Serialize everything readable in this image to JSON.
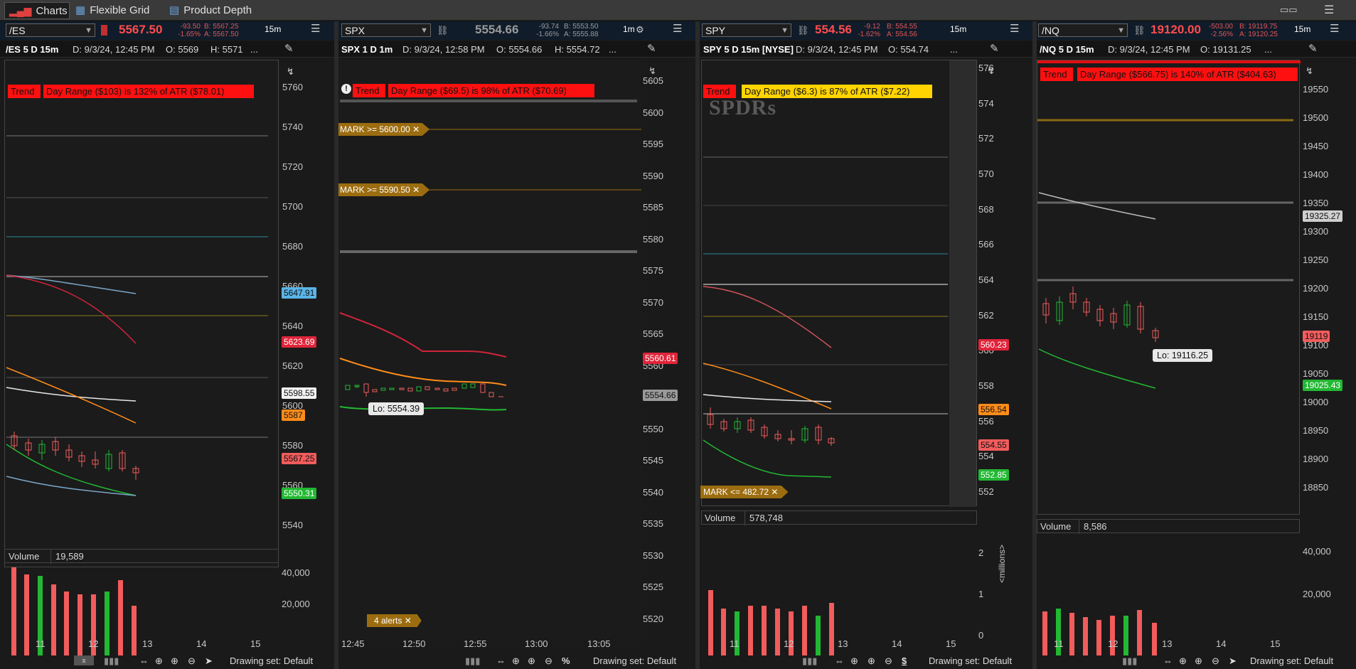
{
  "tabbar": {
    "tabs": [
      {
        "label": "Charts",
        "icon": "bar-chart-icon"
      },
      {
        "label": "Flexible Grid",
        "icon": "grid-icon"
      },
      {
        "label": "Product Depth",
        "icon": "depth-icon"
      }
    ]
  },
  "panels": [
    {
      "symbol": "/ES",
      "last": "5567.50",
      "last_color": "#ff4d4d",
      "change": "-93.50",
      "change_pct": "-1.65%",
      "bid": "B: 5567.25",
      "ask": "A: 5567.50",
      "timeframe": "15m",
      "info_title": "/ES 5 D 15m",
      "info_date": "D: 9/3/24, 12:45 PM",
      "info_open": "O: 5569",
      "info_high": "H: 5571",
      "info_more": "...",
      "badge_trend": "Trend",
      "badge_range": "Day Range ($103) is 132% of ATR ($78.01)",
      "y_ticks": [
        "5760",
        "5740",
        "5720",
        "5700",
        "5680",
        "5660",
        "5640",
        "5620",
        "5600",
        "5580",
        "5560",
        "5540"
      ],
      "tags": [
        {
          "text": "5647.91",
          "bg": "#5ab4e6",
          "fg": "#111"
        },
        {
          "text": "5623.69",
          "bg": "#e0243a",
          "fg": "#fff"
        },
        {
          "text": "5598.55",
          "bg": "#f2f2f2",
          "fg": "#111"
        },
        {
          "text": "5587",
          "bg": "#ff8c1a",
          "fg": "#111"
        },
        {
          "text": "5567.25",
          "bg": "#f25c5c",
          "fg": "#111"
        },
        {
          "text": "5550.31",
          "bg": "#22b833",
          "fg": "#fff"
        }
      ],
      "volume_label": "Volume",
      "volume_value": "19,589",
      "vol_ticks": [
        "40,000",
        "20,000"
      ],
      "x_ticks": [
        "11",
        "12",
        "13",
        "14",
        "15"
      ],
      "drawing_set": "Drawing set: Default"
    },
    {
      "symbol": "SPX",
      "last": "5554.66",
      "last_color": "#9a9a9a",
      "change": "-93.74",
      "change_pct": "-1.66%",
      "bid": "B: 5553.50",
      "ask": "A: 5555.88",
      "timeframe": "1m",
      "info_title": "SPX 1 D 1m",
      "info_date": "D: 9/3/24, 12:58 PM",
      "info_open": "O: 5554.66",
      "info_high": "H: 5554.72",
      "info_more": "...",
      "badge_trend": "Trend",
      "badge_range": "Day Range ($69.5) is 98% of ATR ($70.69)",
      "y_ticks": [
        "5605",
        "5600",
        "5595",
        "5590",
        "5585",
        "5580",
        "5575",
        "5570",
        "5565",
        "5560",
        "5555",
        "5550",
        "5545",
        "5540",
        "5535",
        "5530",
        "5525",
        "5520"
      ],
      "tags": [
        {
          "text": "5560.61",
          "bg": "#e0243a",
          "fg": "#fff"
        },
        {
          "text": "5554.66",
          "bg": "#9a9a9a",
          "fg": "#111"
        }
      ],
      "alerts": [
        "MARK >= 5600.00",
        "MARK >= 5590.50"
      ],
      "bubble": "Lo: 5554.39",
      "alerts_count": "4 alerts",
      "x_ticks": [
        "12:45",
        "12:50",
        "12:55",
        "13:00",
        "13:05"
      ],
      "drawing_set": "Drawing set: Default"
    },
    {
      "symbol": "SPY",
      "last": "554.56",
      "last_color": "#ff4d4d",
      "change": "-9.12",
      "change_pct": "-1.62%",
      "bid": "B: 554.55",
      "ask": "A: 554.56",
      "timeframe": "15m",
      "info_title": "SPY 5 D 15m [NYSE]",
      "info_date": "D: 9/3/24, 12:45 PM",
      "info_open": "O: 554.74",
      "info_more": "...",
      "badge_trend": "Trend",
      "badge_range": "Day Range ($6.3) is 87% of ATR ($7.22)",
      "watermark": "SPDRs",
      "y_ticks": [
        "576",
        "574",
        "572",
        "570",
        "568",
        "566",
        "564",
        "562",
        "560",
        "558",
        "556",
        "554",
        "552"
      ],
      "tags": [
        {
          "text": "560.23",
          "bg": "#e0243a",
          "fg": "#fff"
        },
        {
          "text": "556.54",
          "bg": "#ff8c1a",
          "fg": "#111"
        },
        {
          "text": "554.55",
          "bg": "#f25c5c",
          "fg": "#111"
        },
        {
          "text": "552.85",
          "bg": "#22b833",
          "fg": "#fff"
        }
      ],
      "alerts": [
        "MARK <= 482.72"
      ],
      "volume_label": "Volume",
      "volume_value": "578,748",
      "vol_ticks": [
        "2",
        "1",
        "0"
      ],
      "vol_unit": "<millions>",
      "x_ticks": [
        "11",
        "12",
        "13",
        "14",
        "15"
      ],
      "drawing_set": "Drawing set: Default"
    },
    {
      "symbol": "/NQ",
      "last": "19120.00",
      "last_color": "#ff4d4d",
      "change": "-503.00",
      "change_pct": "-2.56%",
      "bid": "B: 19119.75",
      "ask": "A: 19120.25",
      "timeframe": "15m",
      "info_title": "/NQ 5 D 15m",
      "info_date": "D: 9/3/24, 12:45 PM",
      "info_open": "O: 19131.25",
      "info_more": "...",
      "badge_trend": "Trend",
      "badge_range": "Day Range ($566.75) is 140% of ATR ($404.63)",
      "y_ticks": [
        "19550",
        "19500",
        "19450",
        "19400",
        "19350",
        "19300",
        "19250",
        "19200",
        "19150",
        "19100",
        "19050",
        "19000",
        "18950",
        "18900",
        "18850"
      ],
      "tags": [
        {
          "text": "19325.27",
          "bg": "#cfcfcf",
          "fg": "#111"
        },
        {
          "text": "19119",
          "bg": "#f25c5c",
          "fg": "#111"
        },
        {
          "text": "19025.43",
          "bg": "#22b833",
          "fg": "#fff"
        }
      ],
      "bubble": "Lo: 19116.25",
      "volume_label": "Volume",
      "volume_value": "8,586",
      "vol_ticks": [
        "40,000",
        "20,000"
      ],
      "x_ticks": [
        "11",
        "12",
        "13",
        "14",
        "15"
      ],
      "drawing_set": "Drawing set: Default"
    }
  ]
}
